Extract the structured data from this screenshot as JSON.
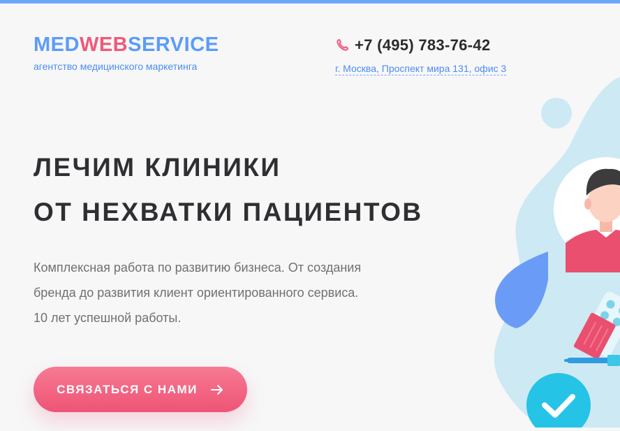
{
  "header": {
    "logo": {
      "part1": "MED",
      "part2": "WEB",
      "part3": "SERVICE"
    },
    "tagline": "агентство медицинского маркетинга",
    "phone": "+7 (495) 783-76-42",
    "address": "г. Москва, Проспект мира 131, офис 3"
  },
  "hero": {
    "title_line1": "ЛЕЧИМ КЛИНИКИ",
    "title_line2": "ОТ НЕХВАТКИ ПАЦИЕНТОВ",
    "desc_line1": "Комплексная работа по развитию бизнеса. От создания",
    "desc_line2": "бренда до развития клиент ориентированного сервиса.",
    "desc_line3": "10 лет успешной работы.",
    "cta_label": "СВЯЗАТЬСЯ С НАМИ"
  },
  "icons": {
    "phone": "phone-icon",
    "cta_arrow": "arrow-right-icon",
    "check": "check-icon"
  },
  "colors": {
    "accent_blue": "#5b9cf7",
    "accent_pink": "#f0597a",
    "text_dark": "#2f2f33",
    "background": "#f7f7f8"
  }
}
